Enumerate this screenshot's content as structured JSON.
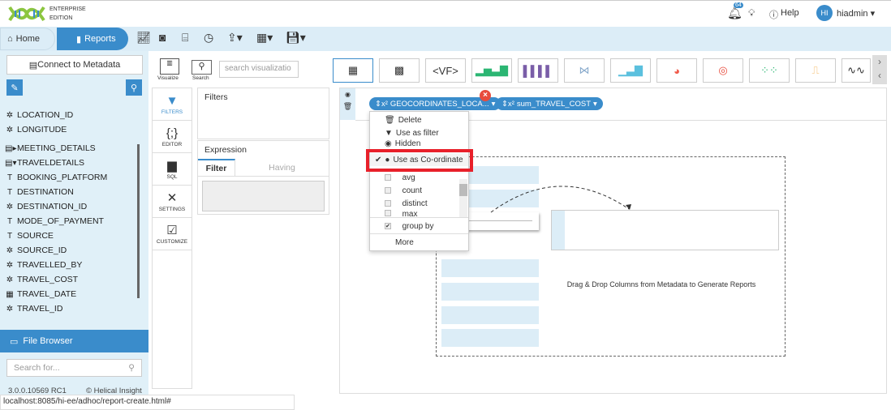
{
  "header": {
    "brand_line1": "ENTERPRISE",
    "brand_line2": "EDITION",
    "notification_count": "64",
    "help_label": "Help",
    "avatar_initials": "HI",
    "username": "hiadmin"
  },
  "nav": {
    "home_label": "Home",
    "reports_label": "Reports"
  },
  "sidebar": {
    "connect_label": "Connect to Metadata",
    "tree": [
      {
        "label": "LOCATION_ID",
        "icon": "gear-icon"
      },
      {
        "label": "LONGITUDE",
        "icon": "gear-icon"
      },
      {
        "label": "MEETING_DETAILS",
        "icon": "table-expand-icon"
      },
      {
        "label": "TRAVELDETAILS",
        "icon": "table-collapse-icon"
      },
      {
        "label": "BOOKING_PLATFORM",
        "icon": "text-icon"
      },
      {
        "label": "DESTINATION",
        "icon": "text-icon"
      },
      {
        "label": "DESTINATION_ID",
        "icon": "gear-icon"
      },
      {
        "label": "MODE_OF_PAYMENT",
        "icon": "text-icon"
      },
      {
        "label": "SOURCE",
        "icon": "text-icon"
      },
      {
        "label": "SOURCE_ID",
        "icon": "gear-icon"
      },
      {
        "label": "TRAVELLED_BY",
        "icon": "gear-icon"
      },
      {
        "label": "TRAVEL_COST",
        "icon": "gear-icon"
      },
      {
        "label": "TRAVEL_DATE",
        "icon": "calendar-icon"
      },
      {
        "label": "TRAVEL_ID",
        "icon": "gear-icon"
      }
    ],
    "file_browser_label": "File Browser",
    "search_placeholder": "Search for...",
    "version": "3.0.0.10569 RC1",
    "copyright": "© Helical Insight"
  },
  "status_url": "localhost:8085/hi-ee/adhoc/report-create.html#",
  "viz": {
    "visualize_label": "Visualize",
    "search_label": "Search",
    "search_placeholder": "search visualizatio",
    "thumbnails": [
      "table",
      "pivot-table",
      "vf",
      "bar",
      "multi-bar",
      "sankey",
      "area",
      "pie",
      "donut",
      "scatter",
      "step",
      "line"
    ]
  },
  "tools": [
    {
      "label": "FILTERS",
      "icon": "funnel-icon"
    },
    {
      "label": "EDITOR",
      "icon": "code-icon"
    },
    {
      "label": "SQL",
      "icon": "sql-file-icon"
    },
    {
      "label": "SETTINGS",
      "icon": "tools-icon"
    },
    {
      "label": "CUSTOMIZE",
      "icon": "customize-icon"
    }
  ],
  "filters": {
    "title": "Filters"
  },
  "expression": {
    "title": "Expression",
    "tab_filter": "Filter",
    "tab_having": "Having",
    "value": ""
  },
  "canvas": {
    "pills": [
      "GEOCORDINATES_LOCA...",
      "sum_TRAVEL_COST"
    ],
    "pill_prefix": "⇕x²",
    "hint": "Drag & Drop Columns from Metadata to Generate Reports"
  },
  "dropdown": {
    "delete": "Delete",
    "use_as_filter": "Use as filter",
    "hidden": "Hidden",
    "use_as_coordinate": "Use as Co-ordinate",
    "avg": "avg",
    "count": "count",
    "distinct": "distinct",
    "max": "max",
    "group_by": "group by",
    "more": "More",
    "coordinate_checked": true,
    "group_by_checked": true
  },
  "colors": {
    "accent": "#3a8ccb",
    "nav_bg": "#dcedf7",
    "highlight": "#e8202a",
    "close_badge": "#e84c3d"
  }
}
